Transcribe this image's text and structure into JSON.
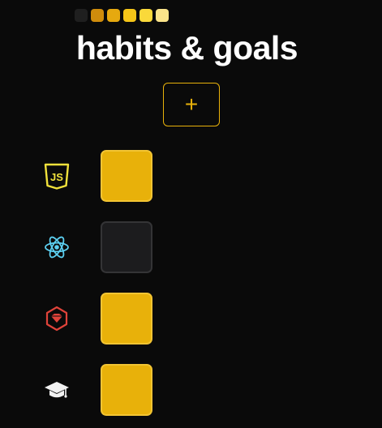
{
  "legend": {
    "levels": [
      "#1f1f1f",
      "#cf8c0c",
      "#e6a90f",
      "#f5c518",
      "#fad93a",
      "#fbe48a"
    ]
  },
  "header": {
    "title": "habits & goals"
  },
  "add_button": {
    "label": "+"
  },
  "habits": [
    {
      "icon": "javascript-icon",
      "done": true
    },
    {
      "icon": "react-icon",
      "done": false
    },
    {
      "icon": "ruby-gem-icon",
      "done": true
    },
    {
      "icon": "graduation-cap-icon",
      "done": true
    }
  ],
  "colors": {
    "accent": "#e8b10a",
    "cell_done": "#e8b10a",
    "cell_empty": "#1c1c1e",
    "background": "#0a0a0a"
  }
}
